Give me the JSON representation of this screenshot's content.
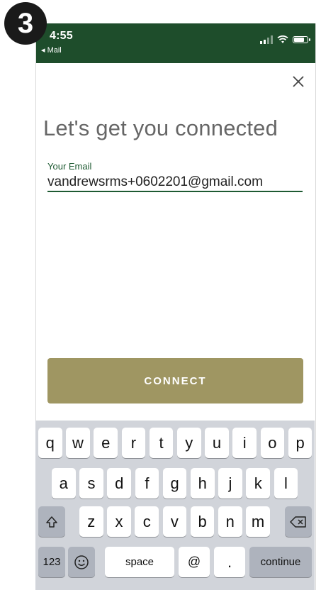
{
  "step_number": "3",
  "status_bar": {
    "time": "4:55",
    "back_app": "◂ Mail",
    "signal_icon": "signal-bars-icon",
    "wifi_icon": "wifi-icon",
    "battery_icon": "battery-icon",
    "battery_level": 0.85
  },
  "theme": {
    "status_bar_bg": "#1e4d2b",
    "accent_green": "#1e5a32",
    "button_bg": "#9f9662"
  },
  "close_icon": "close-icon",
  "title": "Let's get you connected",
  "email": {
    "label": "Your Email",
    "value": "vandrewsrms+0602201@gmail.com"
  },
  "connect_label": "CONNECT",
  "keyboard": {
    "row1": [
      "q",
      "w",
      "e",
      "r",
      "t",
      "y",
      "u",
      "i",
      "o",
      "p"
    ],
    "row2": [
      "a",
      "s",
      "d",
      "f",
      "g",
      "h",
      "j",
      "k",
      "l"
    ],
    "row3": [
      "z",
      "x",
      "c",
      "v",
      "b",
      "n",
      "m"
    ],
    "shift_icon": "shift-icon",
    "delete_icon": "backspace-icon",
    "numbers": "123",
    "emoji_icon": "emoji-icon",
    "space": "space",
    "at": "@",
    "dot": ".",
    "continue": "continue"
  }
}
